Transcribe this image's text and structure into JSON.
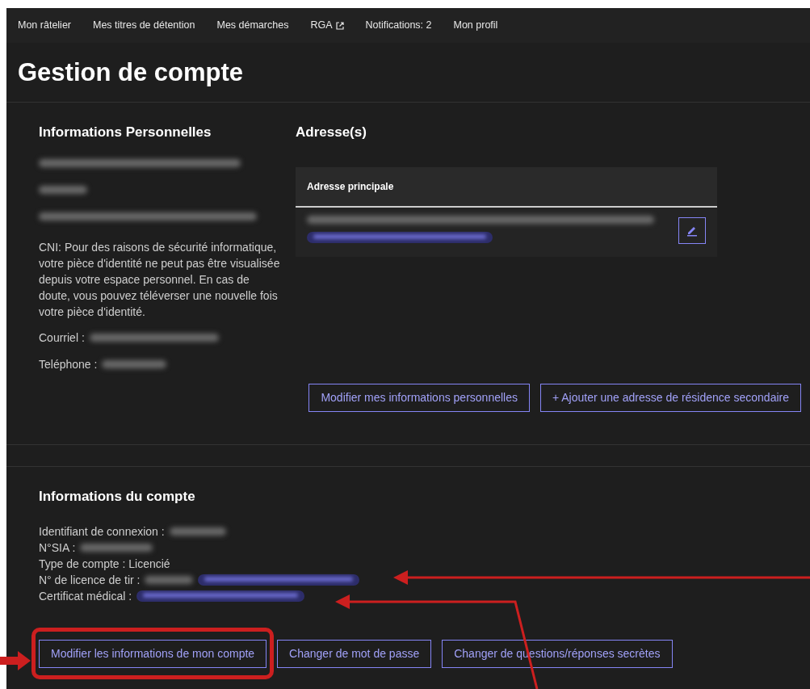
{
  "nav": [
    {
      "label": "Mon râtelier",
      "external": false
    },
    {
      "label": "Mes titres de détention",
      "external": false
    },
    {
      "label": "Mes démarches",
      "external": false
    },
    {
      "label": "RGA",
      "external": true
    },
    {
      "label": "Notifications: 2",
      "external": false
    },
    {
      "label": "Mon profil",
      "external": false
    }
  ],
  "page_title": "Gestion de compte",
  "personal": {
    "title": "Informations Personnelles",
    "lines": [
      {
        "kind": "redacted"
      },
      {
        "kind": "redacted"
      },
      {
        "kind": "redacted"
      },
      {
        "kind": "text",
        "text": "CNI: Pour des raisons de sécurité informatique, votre pièce d'identité ne peut pas être visualisée depuis votre espace personnel. En cas de doute, vous pouvez téléverser une nouvelle fois votre pièce d'identité."
      },
      {
        "kind": "field",
        "label": "Courriel :"
      },
      {
        "kind": "field",
        "label": "Teléphone :"
      }
    ]
  },
  "addresses": {
    "title": "Adresse(s)",
    "card_title": "Adresse principale"
  },
  "personal_buttons": [
    "Modifier mes informations personnelles",
    "+ Ajouter une adresse de résidence secondaire"
  ],
  "account": {
    "title": "Informations du compte",
    "rows": [
      {
        "label": "Identifiant de connexion :",
        "redacted": true,
        "attachment": false
      },
      {
        "label": "N°SIA :",
        "redacted": true,
        "attachment": false
      },
      {
        "label": "Type de compte : Licencié",
        "redacted": false,
        "attachment": false
      },
      {
        "label": "N° de licence de tir :",
        "redacted": true,
        "attachment": true
      },
      {
        "label": "Certificat médical :",
        "redacted": false,
        "attachment": true
      }
    ]
  },
  "account_buttons": [
    {
      "label": "Modifier les informations de mon compte",
      "highlighted": true
    },
    {
      "label": "Changer de mot de passe",
      "highlighted": false
    },
    {
      "label": "Changer de questions/réponses secrètes",
      "highlighted": false
    }
  ]
}
